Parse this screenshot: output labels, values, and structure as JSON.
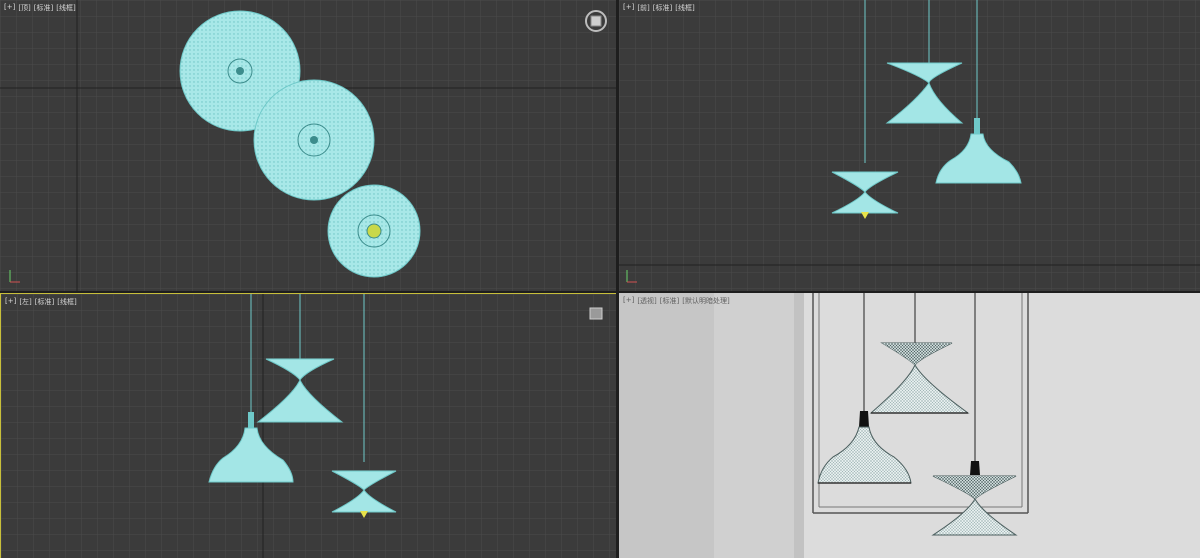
{
  "viewports": {
    "top": {
      "label_plus": "[+]",
      "label_view": "[顶]",
      "label_shade": "[标准]",
      "label_mode": "[线框]"
    },
    "front": {
      "label_plus": "[+]",
      "label_view": "[前]",
      "label_shade": "[标准]",
      "label_mode": "[线框]"
    },
    "left": {
      "label_plus": "[+]",
      "label_view": "[左]",
      "label_shade": "[标准]",
      "label_mode": "[线框]"
    },
    "persp": {
      "label_plus": "[+]",
      "label_view": "[透视]",
      "label_shade": "[标准]",
      "label_mode": "[默认明暗处理]"
    }
  },
  "colors": {
    "grid_bg": "#3b3b3b",
    "grid_line": "#4a4a4a",
    "grid_axis": "#1f1f1f",
    "wire_fill": "#a3e6e6",
    "wire_stroke": "#6fc9c9",
    "selected_highlight": "#e8e34a",
    "active_border": "#c8bf3a",
    "persp_bg": "#cfcfcf",
    "persp_wall": "#d9d9d9"
  },
  "icons": {
    "viewcube": "viewcube-icon",
    "axis": "axis-tripod-icon"
  }
}
